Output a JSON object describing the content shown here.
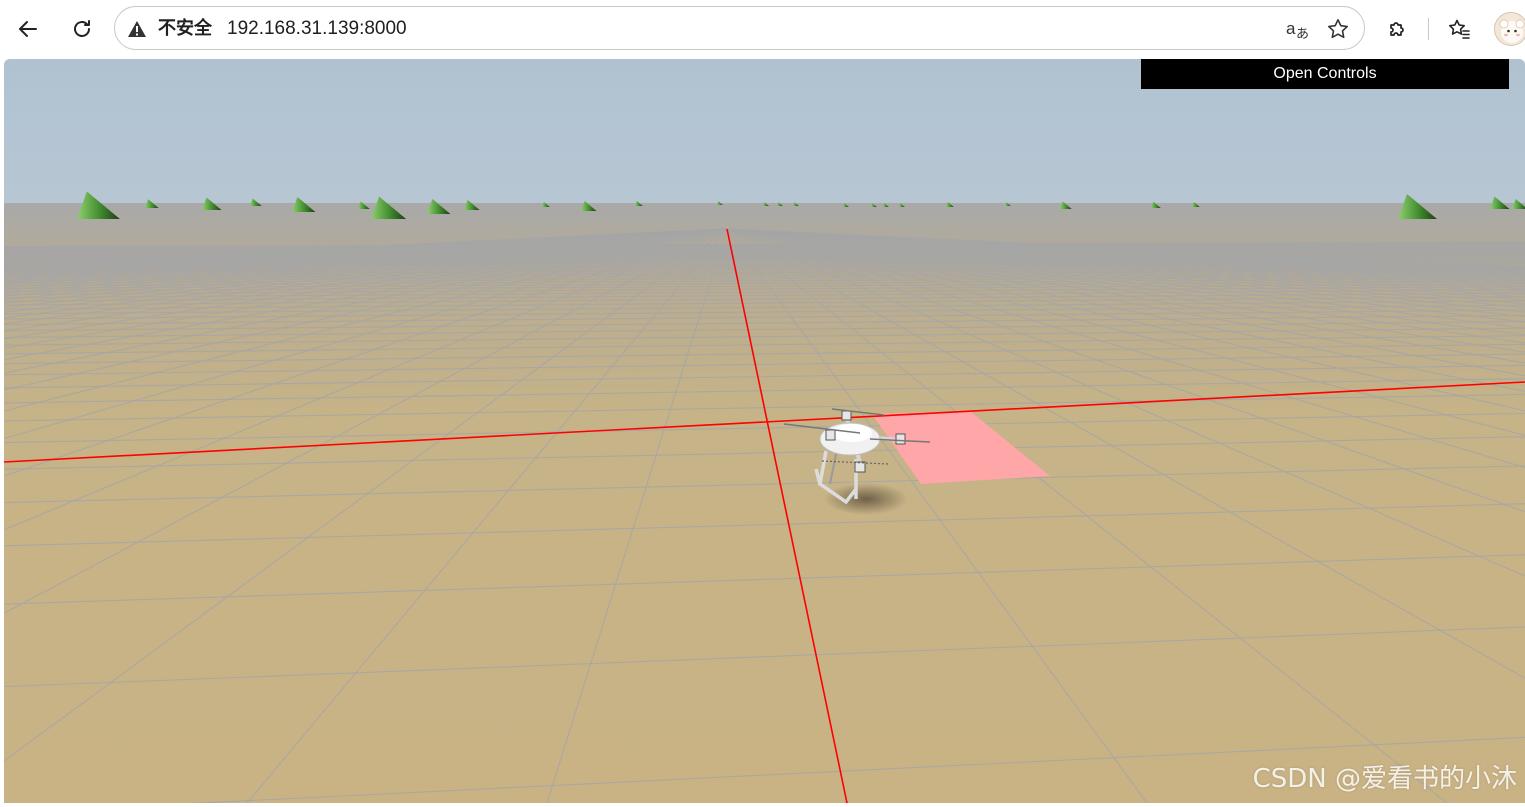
{
  "browser": {
    "security_label": "不安全",
    "url": "192.168.31.139:8000",
    "icons": {
      "back": "back-arrow-icon",
      "reload": "reload-icon",
      "warning": "warning-icon",
      "translate": "translate-icon",
      "favorite": "star-icon",
      "extensions": "puzzle-icon",
      "favorites": "favorites-icon",
      "profile": "avatar"
    }
  },
  "page": {
    "controls_button_label": "Open Controls",
    "watermark": "CSDN @爱看书的小沐"
  },
  "colors": {
    "sky": "#b3c4d2",
    "horizon_ground": "#a8a8a8",
    "ground": "#c9b385",
    "grid_line": "#a6a6a6",
    "axis": "#ff0000",
    "highlight_patch": "#ffa6a8",
    "cone": "#4f9a3c"
  }
}
